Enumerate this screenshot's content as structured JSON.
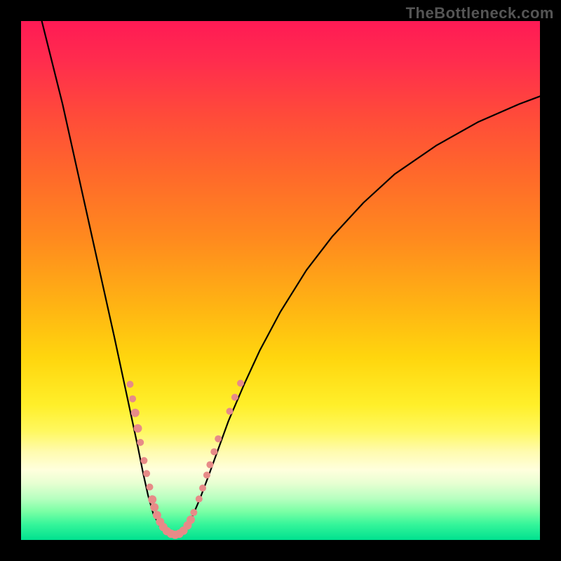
{
  "watermark": "TheBottleneck.com",
  "chart_data": {
    "type": "line",
    "title": "",
    "xlabel": "",
    "ylabel": "",
    "x_range": [
      0,
      100
    ],
    "y_range_percent_mismatch": [
      0,
      100
    ],
    "note": "Bottleneck-style V curve. x is an unlabeled parameter (0-100), y is percent mismatch (0 at bottom = balanced/green, 100 at top = severe/red). Axes are unlabeled in the original image; values are estimated from pixel positions.",
    "curve": [
      {
        "x": 4.0,
        "y": 100.0
      },
      {
        "x": 6.0,
        "y": 92.0
      },
      {
        "x": 8.0,
        "y": 84.0
      },
      {
        "x": 10.0,
        "y": 75.0
      },
      {
        "x": 12.0,
        "y": 66.0
      },
      {
        "x": 14.0,
        "y": 57.0
      },
      {
        "x": 16.0,
        "y": 48.0
      },
      {
        "x": 18.0,
        "y": 39.0
      },
      {
        "x": 19.5,
        "y": 32.0
      },
      {
        "x": 21.0,
        "y": 25.0
      },
      {
        "x": 22.5,
        "y": 18.0
      },
      {
        "x": 23.5,
        "y": 13.0
      },
      {
        "x": 24.5,
        "y": 8.5
      },
      {
        "x": 25.5,
        "y": 5.0
      },
      {
        "x": 27.0,
        "y": 2.2
      },
      {
        "x": 28.5,
        "y": 1.0
      },
      {
        "x": 30.0,
        "y": 1.0
      },
      {
        "x": 31.5,
        "y": 2.0
      },
      {
        "x": 33.0,
        "y": 4.5
      },
      {
        "x": 34.5,
        "y": 8.0
      },
      {
        "x": 36.0,
        "y": 12.0
      },
      {
        "x": 38.0,
        "y": 17.5
      },
      {
        "x": 40.0,
        "y": 23.0
      },
      {
        "x": 43.0,
        "y": 30.0
      },
      {
        "x": 46.0,
        "y": 36.5
      },
      {
        "x": 50.0,
        "y": 44.0
      },
      {
        "x": 55.0,
        "y": 52.0
      },
      {
        "x": 60.0,
        "y": 58.5
      },
      {
        "x": 66.0,
        "y": 65.0
      },
      {
        "x": 72.0,
        "y": 70.5
      },
      {
        "x": 80.0,
        "y": 76.0
      },
      {
        "x": 88.0,
        "y": 80.5
      },
      {
        "x": 96.0,
        "y": 84.0
      },
      {
        "x": 100.0,
        "y": 85.5
      }
    ],
    "scatter_points": [
      {
        "x": 21.0,
        "y": 30.0,
        "r": 5
      },
      {
        "x": 21.5,
        "y": 27.2,
        "r": 5
      },
      {
        "x": 22.0,
        "y": 24.5,
        "r": 6
      },
      {
        "x": 22.5,
        "y": 21.5,
        "r": 6
      },
      {
        "x": 23.0,
        "y": 18.8,
        "r": 5
      },
      {
        "x": 23.7,
        "y": 15.3,
        "r": 5
      },
      {
        "x": 24.2,
        "y": 12.8,
        "r": 5
      },
      {
        "x": 24.8,
        "y": 10.2,
        "r": 5
      },
      {
        "x": 25.3,
        "y": 7.8,
        "r": 6
      },
      {
        "x": 25.7,
        "y": 6.3,
        "r": 6
      },
      {
        "x": 26.2,
        "y": 4.8,
        "r": 6
      },
      {
        "x": 26.8,
        "y": 3.5,
        "r": 6
      },
      {
        "x": 27.4,
        "y": 2.5,
        "r": 6
      },
      {
        "x": 28.1,
        "y": 1.7,
        "r": 6
      },
      {
        "x": 28.9,
        "y": 1.2,
        "r": 6
      },
      {
        "x": 29.7,
        "y": 1.0,
        "r": 6
      },
      {
        "x": 30.5,
        "y": 1.2,
        "r": 6
      },
      {
        "x": 31.3,
        "y": 1.8,
        "r": 6
      },
      {
        "x": 32.1,
        "y": 2.8,
        "r": 6
      },
      {
        "x": 32.7,
        "y": 3.9,
        "r": 6
      },
      {
        "x": 33.3,
        "y": 5.3,
        "r": 5
      },
      {
        "x": 34.3,
        "y": 7.9,
        "r": 5
      },
      {
        "x": 35.0,
        "y": 10.0,
        "r": 5
      },
      {
        "x": 35.8,
        "y": 12.5,
        "r": 5
      },
      {
        "x": 36.4,
        "y": 14.5,
        "r": 5
      },
      {
        "x": 37.2,
        "y": 17.0,
        "r": 5
      },
      {
        "x": 38.0,
        "y": 19.5,
        "r": 5
      },
      {
        "x": 40.2,
        "y": 24.8,
        "r": 5
      },
      {
        "x": 41.2,
        "y": 27.5,
        "r": 5
      },
      {
        "x": 42.3,
        "y": 30.2,
        "r": 5
      }
    ]
  }
}
